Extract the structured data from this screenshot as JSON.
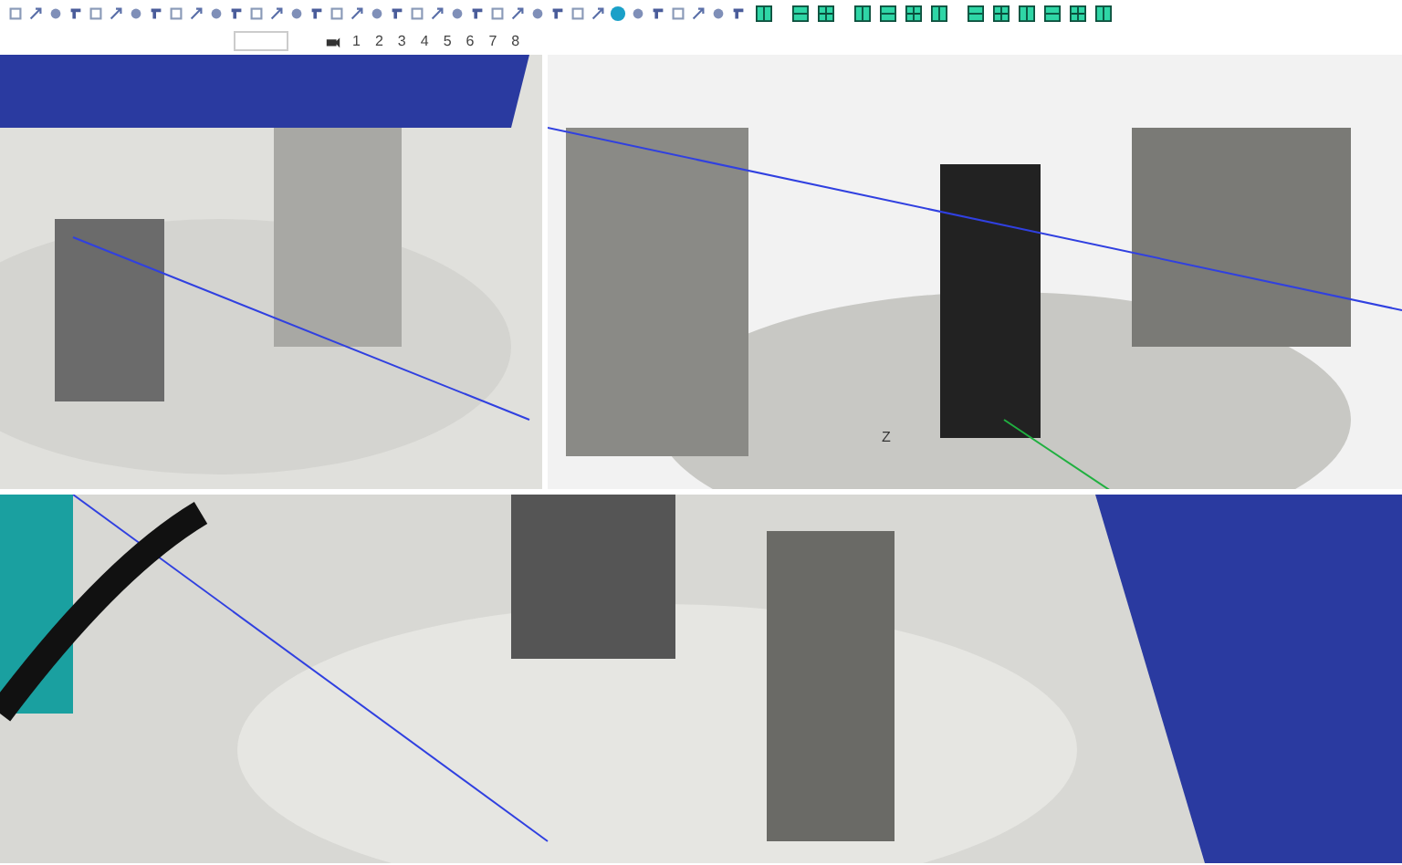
{
  "toolbar": {
    "view_numbers": [
      "1",
      "2",
      "3",
      "4",
      "5",
      "6",
      "7",
      "8"
    ]
  },
  "viewports": [
    {
      "kind": "top_left"
    },
    {
      "kind": "top_right",
      "axis_label": "Z"
    },
    {
      "kind": "bottom"
    }
  ]
}
